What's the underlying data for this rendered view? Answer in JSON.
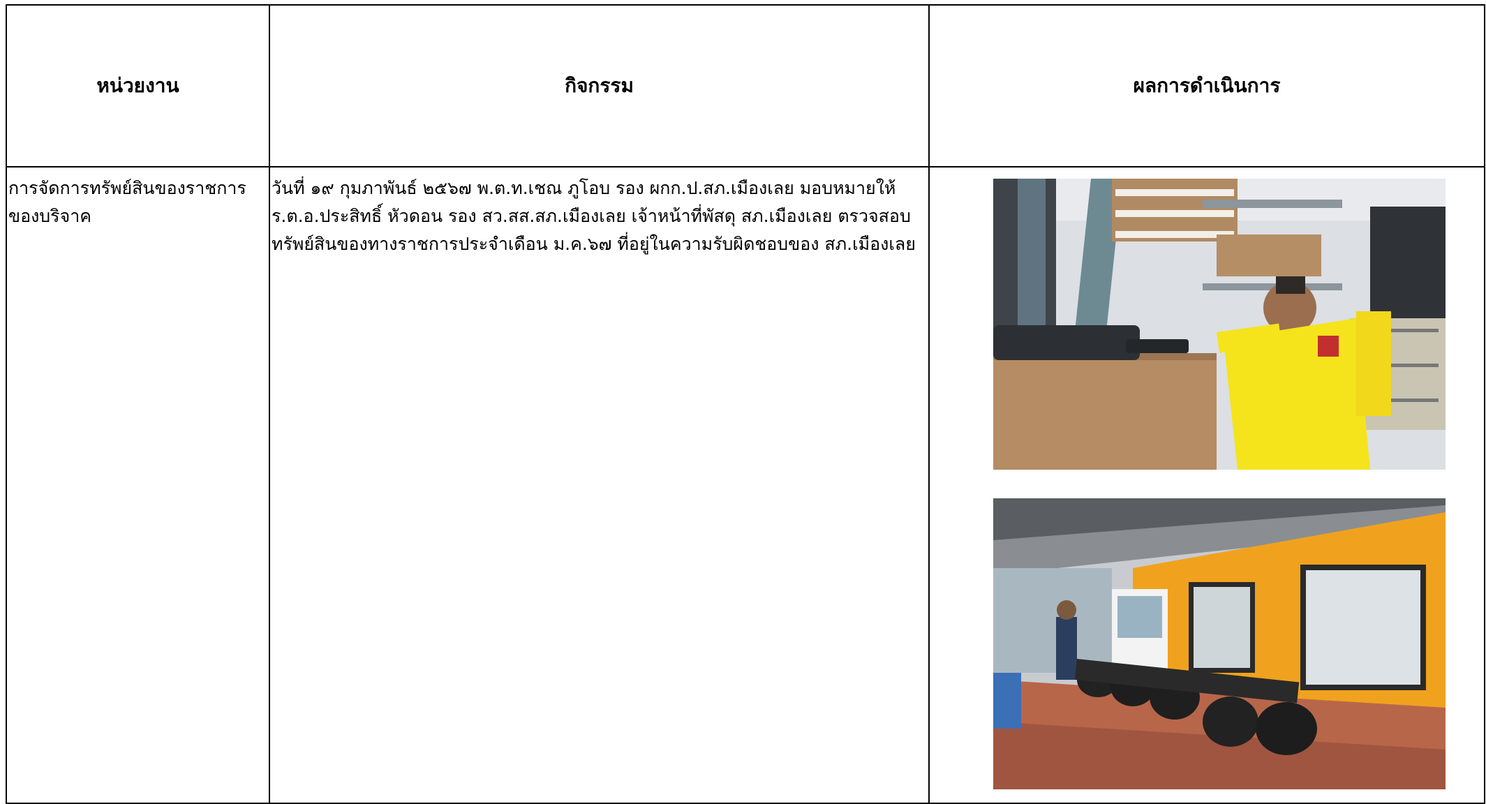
{
  "table": {
    "headers": {
      "unit": "หน่วยงาน",
      "activity": "กิจกรรม",
      "result": "ผลการดำเนินการ"
    },
    "rows": [
      {
        "unit": "การจัดการทรัพย์สินของราชการของบริจาค",
        "activity": "วันที่ ๑๙ กุมภาพันธ์ ๒๕๖๗ พ.ต.ท.เชณ ภูโอบ รอง ผกก.ป.สภ.เมืองเลย มอบหมายให้ ร.ต.อ.ประสิทธิ์ หัวดอน รอง สว.สส.สภ.เมืองเลย เจ้าหน้าที่พัสดุ สภ.เมืองเลย ตรวจสอบ ทรัพย์สินของทางราชการประจำเดือน ม.ค.๖๗ ที่อยู่ในความรับผิดชอบของ สภ.เมืองเลย"
      }
    ]
  },
  "photos": {
    "photo_1": {
      "description_icon": "storage-room-photo"
    },
    "photo_2": {
      "description_icon": "motorcycles-photo"
    }
  }
}
